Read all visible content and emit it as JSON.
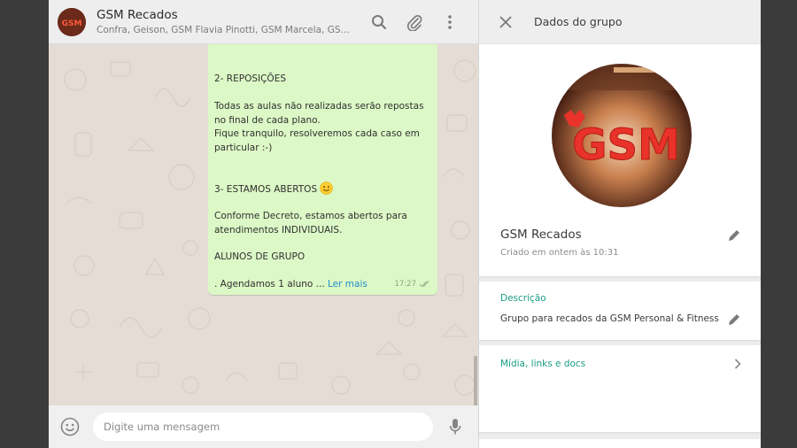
{
  "chat": {
    "title": "GSM Recados",
    "subtitle": "Confra, Geison, GSM Flavia Pinotti, GSM Marcela, GSM, Gsm A...",
    "avatar_text": "GSM",
    "icons": [
      "search-icon",
      "paperclip-icon",
      "menu-dots-icon"
    ]
  },
  "message": {
    "lines": [
      "2- REPOSIÇÕES",
      "Todas as aulas não realizadas serão repostas no final de cada plano.",
      "Fique tranquilo, resolveremos cada caso em particular :-)",
      "3- ESTAMOS ABERTOS",
      "Conforme Decreto, estamos abertos para atendimentos INDIVIDUAIS.",
      "ALUNOS DE GRUPO",
      ". Agendamos 1 aluno ..."
    ],
    "read_more": "Ler mais",
    "time": "17:27"
  },
  "composer": {
    "placeholder": "Digite uma mensagem"
  },
  "info": {
    "title": "Dados do grupo",
    "photo_text": "GSM",
    "group_name": "GSM Recados",
    "created": "Criado em ontem às 10:31",
    "description_label": "Descrição",
    "description": "Grupo para recados da GSM Personal & Fitness",
    "media_label": "Mídia, links e docs"
  },
  "colors": {
    "accent": "#1b9c85",
    "bubble": "#dcf8c6",
    "chat_bg": "#e5ddd5",
    "link": "#1f8fc9",
    "logo_red": "#e8322a"
  }
}
